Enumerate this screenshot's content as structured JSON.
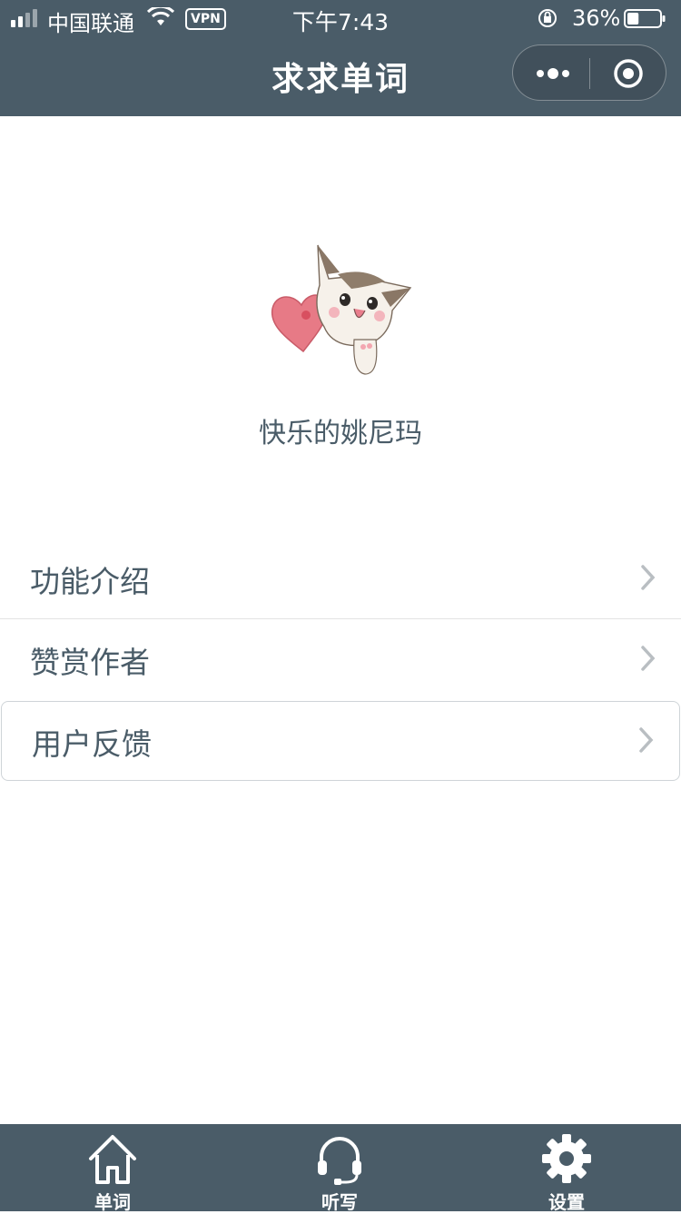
{
  "status_bar": {
    "carrier": "中国联通",
    "vpn": "VPN",
    "time": "下午7:43",
    "battery_percent": "36%",
    "battery_level": 0.36
  },
  "nav": {
    "title": "求求单词"
  },
  "profile": {
    "username": "快乐的姚尼玛"
  },
  "menu": {
    "items": [
      {
        "label": "功能介绍"
      },
      {
        "label": "赞赏作者"
      },
      {
        "label": "用户反馈"
      }
    ]
  },
  "tabbar": {
    "tabs": [
      {
        "label": "单词",
        "icon": "home-icon"
      },
      {
        "label": "听写",
        "icon": "headset-icon"
      },
      {
        "label": "设置",
        "icon": "gear-icon"
      }
    ]
  },
  "colors": {
    "bar_bg": "#4a5c68",
    "text": "#4a5c68",
    "background": "#ffffff"
  }
}
